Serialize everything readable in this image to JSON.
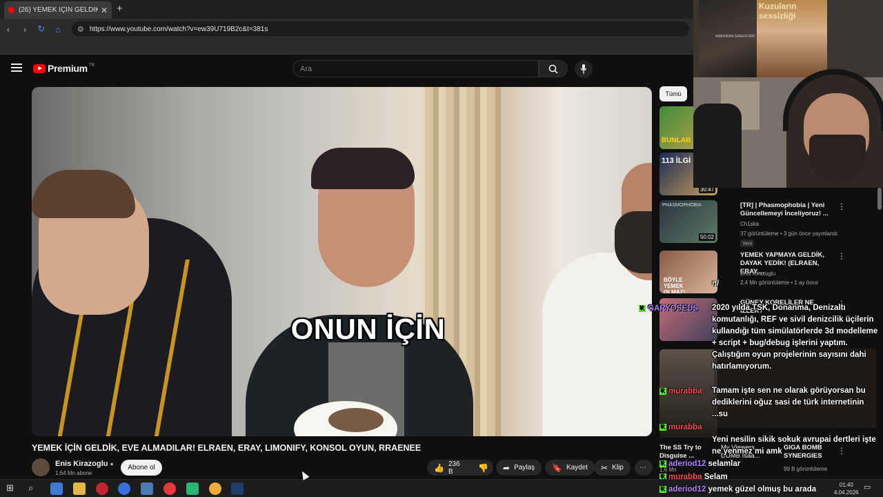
{
  "browser": {
    "tab_title": "(26) YEMEK İÇİN GELDİK, EV",
    "url": "https://www.youtube.com/watch?v=ew39U719B2c&t=381s"
  },
  "youtube": {
    "logo_text": "Premium",
    "logo_region": "TR",
    "search_placeholder": "Ara"
  },
  "video": {
    "caption_overlay": "ONUN İÇİN",
    "title": "YEMEK İÇİN GELDİK, EVE ALMADILAR! ELRAEN, ERAY, LIMONIFY, KONSOL OYUN, RRAENEE",
    "channel": "Enis Kirazoglu",
    "subscribers": "1,64 Mn abone",
    "subscribe_label": "Abone ol",
    "likes": "236 B",
    "share_label": "Paylaş",
    "save_label": "Kaydet",
    "clip_label": "Klip"
  },
  "sidebar": {
    "chip_all": "Tümü",
    "items": [
      {
        "thumb_text": "BUNLAR",
        "duration": ""
      },
      {
        "thumb_text": "113 İLGİ BİLGİ",
        "duration": "30:47"
      },
      {
        "thumb_text": "PHASMOPHOBIA",
        "duration": "50:02",
        "title": "[TR] | Phasmophobia | Yeni Güncellemeyi İnceliyoruz! ...",
        "channel": "Ch1ska",
        "meta": "37 görüntüleme • 3 gün önce yayınlandı",
        "badge": "Yeni"
      },
      {
        "thumb_text": "BÖYLE YEMEK OLMAZ!",
        "duration": "",
        "title": "YEMEK YAPMAYA GELDİK, DAYAK YEDİK! (ELRAEN, ERAY,...",
        "channel": "Enis Kirazoglu",
        "meta": "2,4 Mn görüntüleme • 1 ay önce"
      },
      {
        "thumb_text": "",
        "duration": "",
        "title": "GÜNEY KORELİLER NE İZLER?",
        "channel": "",
        "meta": ""
      },
      {
        "thumb_text": "",
        "duration": "",
        "title": "The SS Try to Disguise ...",
        "channel": "",
        "meta": "1,6 Mn"
      },
      {
        "thumb_text": "",
        "duration": "",
        "title": "My Viewers DUMB Isaa...",
        "channel": "",
        "meta": ""
      },
      {
        "thumb_text": "",
        "duration": "",
        "title": "GIGA BOMB SYNERGIES",
        "channel": "",
        "meta": "99 B görüntüleme"
      }
    ]
  },
  "webcam": {
    "poster_left": "AMERİKAN GANGSTERİ",
    "poster_right": "Kuzuların sessizliği"
  },
  "chat": {
    "top_fragment": "n/",
    "user1": "GARYOSEUS",
    "message1": "2020 yılda TSK, Donanma, Denizaltı komutanlığı, REF ve sivil denizcilik üçilerin kullandığı tüm simülatörlerde 3d modelleme + script + bug/debug işlerini yaptım. Çalıştığım oyun projelerinin sayısını dahi hatırlamıyorum.",
    "message2": "Tamam işte sen ne olarak görüyorsan bu dediklerini oğuz sasi de türk internetinin ...su",
    "user2": "murabba",
    "user3": "murabba",
    "message3": "Yeni nesilin sikik sokuk avrupai dertleri işte ne yenmez mi amk",
    "user4": "aderiod12",
    "message4": "selamlar",
    "user5": "murabba",
    "message5": "Selam",
    "user6": "aderiod12",
    "message6": "yemek güzel olmuş bu arada"
  },
  "taskbar": {
    "time": "01:40",
    "date": "4.04.2026"
  }
}
